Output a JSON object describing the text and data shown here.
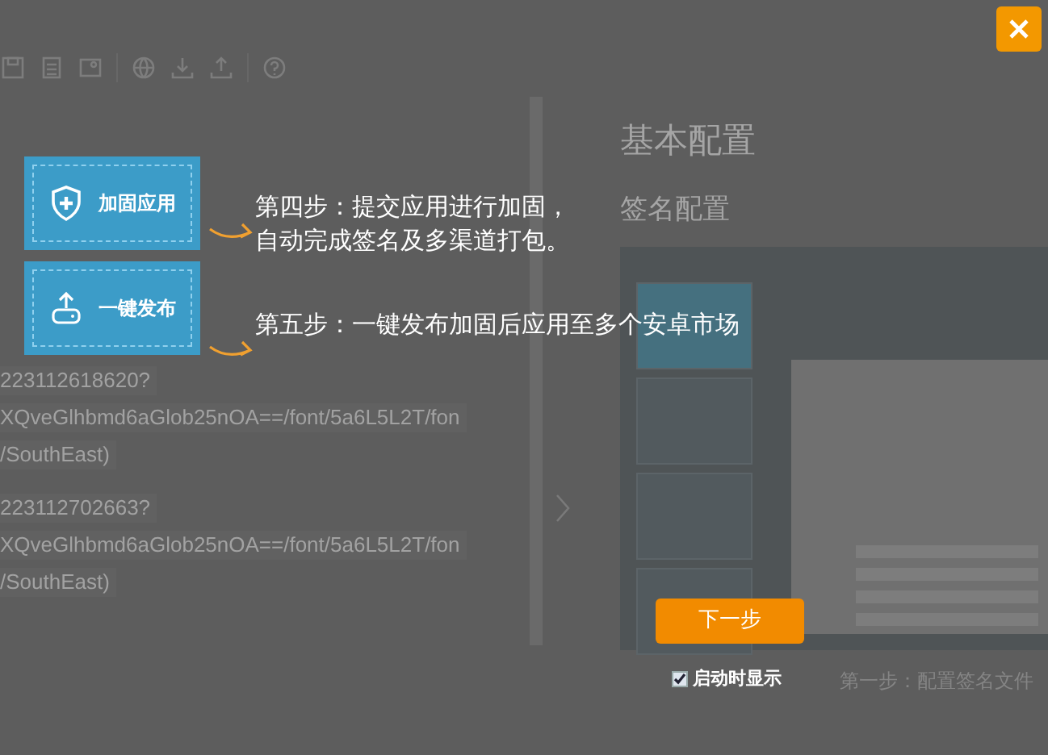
{
  "background": {
    "left_lines": [
      "223112618620?",
      "XQveGlhbmd6aGlob25nOA==/font/5a6L5L2T/fon",
      "/SouthEast)",
      "223112702663?",
      "XQveGlhbmd6aGlob25nOA==/font/5a6L5L2T/fon",
      "/SouthEast)"
    ],
    "headings": [
      "基本配置",
      "签名配置"
    ],
    "footer_step": "第一步：配置签名文件"
  },
  "guide": {
    "features": [
      {
        "label": "加固应用",
        "kind": "shield"
      },
      {
        "label": "一键发布",
        "kind": "upload"
      }
    ],
    "steps": [
      {
        "lines": [
          "第四步：提交应用进行加固，",
          "自动完成签名及多渠道打包。"
        ]
      },
      {
        "lines": [
          "第五步：一键发布加固后应用至多个安卓市场"
        ]
      }
    ],
    "next_button": "下一步",
    "show_on_startup": {
      "label": "启动时显示",
      "checked": true
    }
  }
}
